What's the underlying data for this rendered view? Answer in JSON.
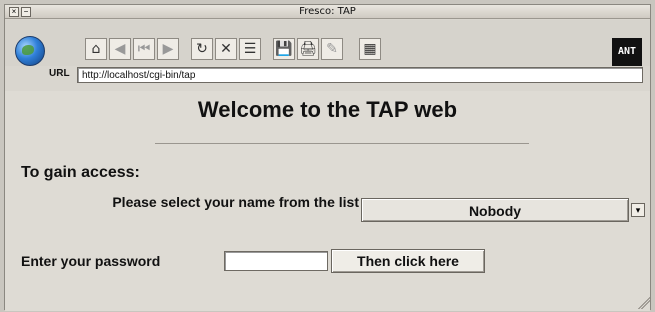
{
  "window": {
    "title": "Fresco: TAP"
  },
  "toolbar": {
    "icons": [
      "globe-icon",
      "home-icon",
      "back-icon",
      "rewind-icon",
      "forward-icon",
      "reload-icon",
      "stop-icon",
      "history-icon",
      "save-icon",
      "print-icon",
      "edit-icon",
      "view-icon"
    ],
    "ant_label": "ANT"
  },
  "url": {
    "label": "URL",
    "value": "http://localhost/cgi-bin/tap"
  },
  "content": {
    "heading": "Welcome to the TAP web",
    "access_title": "To gain access:",
    "select_label": "Please select your name from the list",
    "select_value": "Nobody",
    "password_label": "Enter your password",
    "submit_label": "Then click here"
  }
}
